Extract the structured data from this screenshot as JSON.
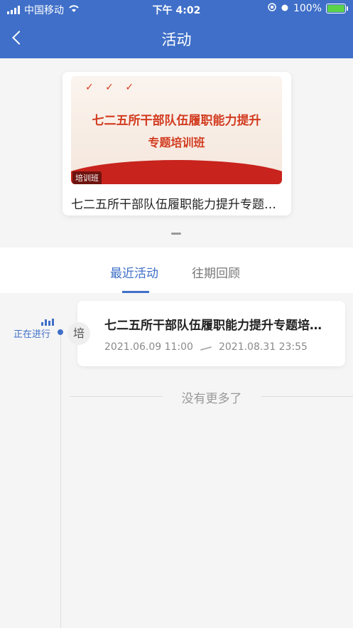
{
  "status_bar": {
    "carrier": "中国移动",
    "time": "下午 4:02",
    "battery": "100%"
  },
  "nav": {
    "title": "活动",
    "back_icon": "chevron-left-icon"
  },
  "banner": {
    "poster_line1": "七二五所干部队伍履职能力提升",
    "poster_line2": "专题培训班",
    "tag": "培训班",
    "title": "七二五所干部队伍履职能力提升专题培训班"
  },
  "tabs": [
    {
      "label": "最近活动",
      "active": true
    },
    {
      "label": "往期回顾",
      "active": false
    }
  ],
  "timeline": {
    "status_label": "正在进行"
  },
  "events": [
    {
      "badge": "培",
      "title": "七二五所干部队伍履职能力提升专题培训班",
      "start": "2021.06.09 11:00",
      "end": "2021.08.31 23:55"
    }
  ],
  "footer": {
    "no_more": "没有更多了"
  },
  "colors": {
    "primary": "#3f6fc8",
    "background": "#f5f5f5",
    "poster_red": "#d23b1f"
  }
}
